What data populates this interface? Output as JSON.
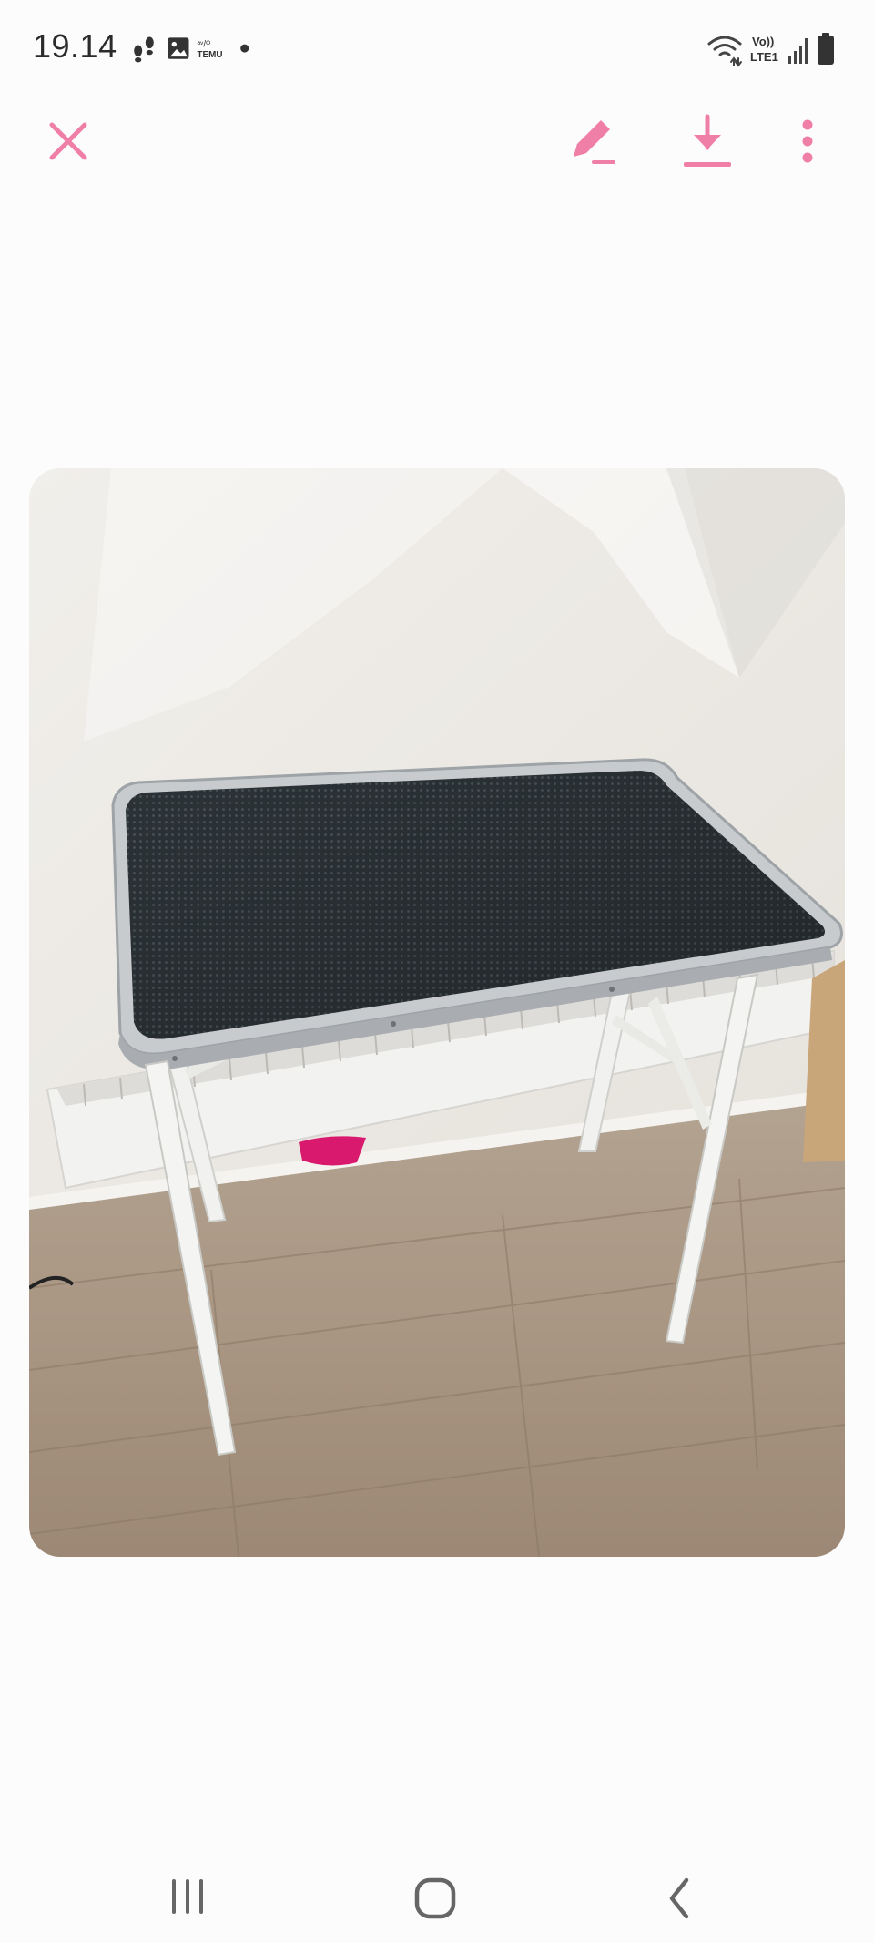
{
  "status_bar": {
    "time": "19.14",
    "left_icons": [
      "footprints-icon",
      "gallery-icon",
      "temu-app-icon",
      "notification-dot-icon"
    ],
    "right_icons": [
      "wifi-icon",
      "volte-icon",
      "signal-icon",
      "battery-icon"
    ],
    "volte_line1": "Vo))",
    "volte_line2": "LTE1",
    "temu_line1": "ᵃᵛ/ᴼ",
    "temu_line2": "TEMU"
  },
  "toolbar": {
    "accent_color": "#f07fa8",
    "buttons": [
      "close-icon",
      "edit-icon",
      "download-icon",
      "more-options-icon"
    ]
  },
  "photo": {
    "subject": "folding grooming table with dark rubber mat top and white legs on wooden floor"
  },
  "nav_bar": {
    "buttons": [
      "recent-apps-icon",
      "home-icon",
      "back-icon"
    ]
  }
}
